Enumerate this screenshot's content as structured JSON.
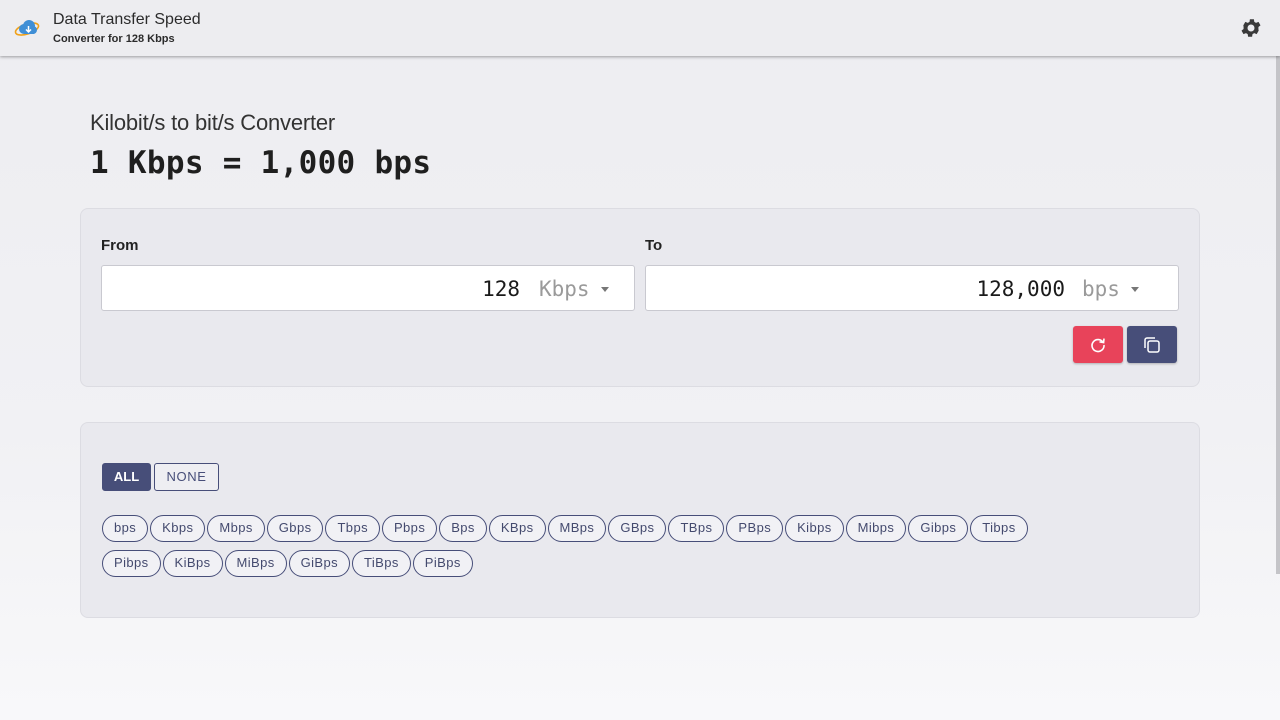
{
  "header": {
    "title": "Data Transfer Speed",
    "subtitle": "Converter for 128 Kbps",
    "logo_icon": "cloud-globe-logo",
    "settings_icon": "gear-icon"
  },
  "heading": {
    "title": "Kilobit/s to bit/s Converter",
    "formula": "1 Kbps = 1,000 bps"
  },
  "converter": {
    "from_label": "From",
    "from_value": "128",
    "from_unit": "Kbps",
    "to_label": "To",
    "to_value": "128,000",
    "to_unit": "bps",
    "reset_icon": "refresh-icon",
    "copy_icon": "copy-icon"
  },
  "units": {
    "all_label": "ALL",
    "none_label": "NONE",
    "chips": [
      "bps",
      "Kbps",
      "Mbps",
      "Gbps",
      "Tbps",
      "Pbps",
      "Bps",
      "KBps",
      "MBps",
      "GBps",
      "TBps",
      "PBps",
      "Kibps",
      "Mibps",
      "Gibps",
      "Tibps",
      "Pibps",
      "KiBps",
      "MiBps",
      "GiBps",
      "TiBps",
      "PiBps"
    ]
  },
  "colors": {
    "accent": "#474e79",
    "reset": "#e8435a"
  }
}
